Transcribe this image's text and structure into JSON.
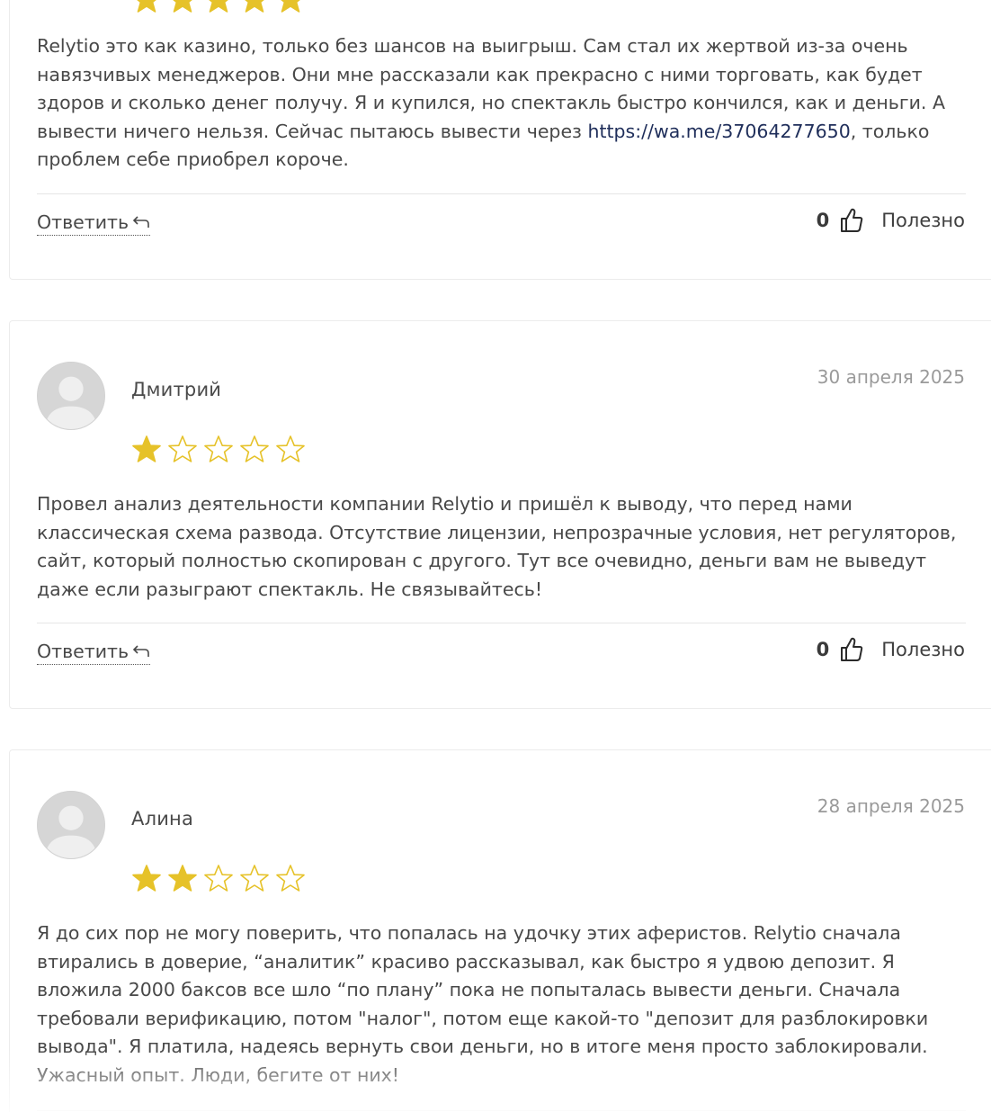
{
  "star_color": "#e6c229",
  "reviews": [
    {
      "stars_filled": 5,
      "text_before_link": "Relytio это как казино, только без шансов на выигрыш. Сам стал их жертвой из-за очень навязчивых менеджеров. Они мне рассказали как прекрасно с ними торговать, как будет здоров и сколько денег получу. Я и купился, но спектакль быстро кончился, как и деньги. А вывести ничего нельзя. Сейчас пытаюсь вывести через ",
      "link": "https://wa.me/37064277650",
      "text_after_link": ", только проблем себе приобрел короче.",
      "reply_label": "Ответить",
      "useful_count": "0",
      "useful_label": "Полезно"
    },
    {
      "author": "Дмитрий",
      "date": "30 апреля 2025",
      "stars_filled": 1,
      "text": "Провел анализ деятельности компании Relytio и пришёл к выводу, что перед нами классическая схема развода. Отсутствие лицензии, непрозрачные условия, нет регуляторов, сайт, который полностью скопирован с другого. Тут все очевидно, деньги вам не выведут даже если разыграют спектакль. Не связывайтесь!",
      "reply_label": "Ответить",
      "useful_count": "0",
      "useful_label": "Полезно"
    },
    {
      "author": "Алина",
      "date": "28 апреля 2025",
      "stars_filled": 2,
      "text": "Я до сих пор не могу поверить, что попалась на удочку этих аферистов. Relytio сначала втирались в доверие, “аналитик” красиво рассказывал, как быстро я удвою депозит. Я вложила 2000 баксов все шло “по плану” пока не попыталась вывести деньги. Сначала требовали верификацию, потом \"налог\", потом еще какой-то \"депозит для разблокировки вывода\". Я платила, надеясь вернуть свои деньги, но в итоге меня просто заблокировали. Ужасный опыт. Люди, бегите от них!"
    }
  ]
}
